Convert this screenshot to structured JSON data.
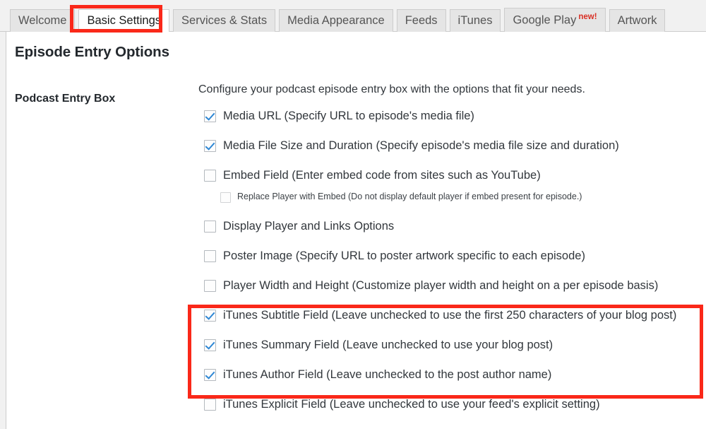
{
  "tabs": [
    {
      "label": "Welcome",
      "active": false,
      "badge": ""
    },
    {
      "label": "Basic Settings",
      "active": true,
      "badge": ""
    },
    {
      "label": "Services & Stats",
      "active": false,
      "badge": ""
    },
    {
      "label": "Media Appearance",
      "active": false,
      "badge": ""
    },
    {
      "label": "Feeds",
      "active": false,
      "badge": ""
    },
    {
      "label": "iTunes",
      "active": false,
      "badge": ""
    },
    {
      "label": "Google Play",
      "active": false,
      "badge": "new!"
    },
    {
      "label": "Artwork",
      "active": false,
      "badge": ""
    }
  ],
  "page": {
    "title": "Episode Entry Options",
    "section_label": "Podcast Entry Box",
    "intro": "Configure your podcast episode entry box with the options that fit your needs."
  },
  "options": [
    {
      "label": "Media URL (Specify URL to episode's media file)",
      "checked": true,
      "sub": false
    },
    {
      "label": "Media File Size and Duration (Specify episode's media file size and duration)",
      "checked": true,
      "sub": false
    },
    {
      "label": "Embed Field (Enter embed code from sites such as YouTube)",
      "checked": false,
      "sub": false
    },
    {
      "label": "Replace Player with Embed (Do not display default player if embed present for episode.)",
      "checked": false,
      "sub": true
    },
    {
      "label": "Display Player and Links Options",
      "checked": false,
      "sub": false
    },
    {
      "label": "Poster Image (Specify URL to poster artwork specific to each episode)",
      "checked": false,
      "sub": false
    },
    {
      "label": "Player Width and Height (Customize player width and height on a per episode basis)",
      "checked": false,
      "sub": false
    },
    {
      "label": "iTunes Subtitle Field (Leave unchecked to use the first 250 characters of your blog post)",
      "checked": true,
      "sub": false
    },
    {
      "label": "iTunes Summary Field (Leave unchecked to use your blog post)",
      "checked": true,
      "sub": false
    },
    {
      "label": "iTunes Author Field (Leave unchecked to the post author name)",
      "checked": true,
      "sub": false
    },
    {
      "label": "iTunes Explicit Field (Leave unchecked to use your feed's explicit setting)",
      "checked": false,
      "sub": false
    }
  ],
  "highlights": {
    "accent_color": "#fa2819",
    "checkbox_check_color": "#2e87d4",
    "tab_highlight_target": "Basic Settings",
    "itunes_highlight_targets": [
      "iTunes Subtitle Field",
      "iTunes Summary Field",
      "iTunes Author Field"
    ]
  }
}
